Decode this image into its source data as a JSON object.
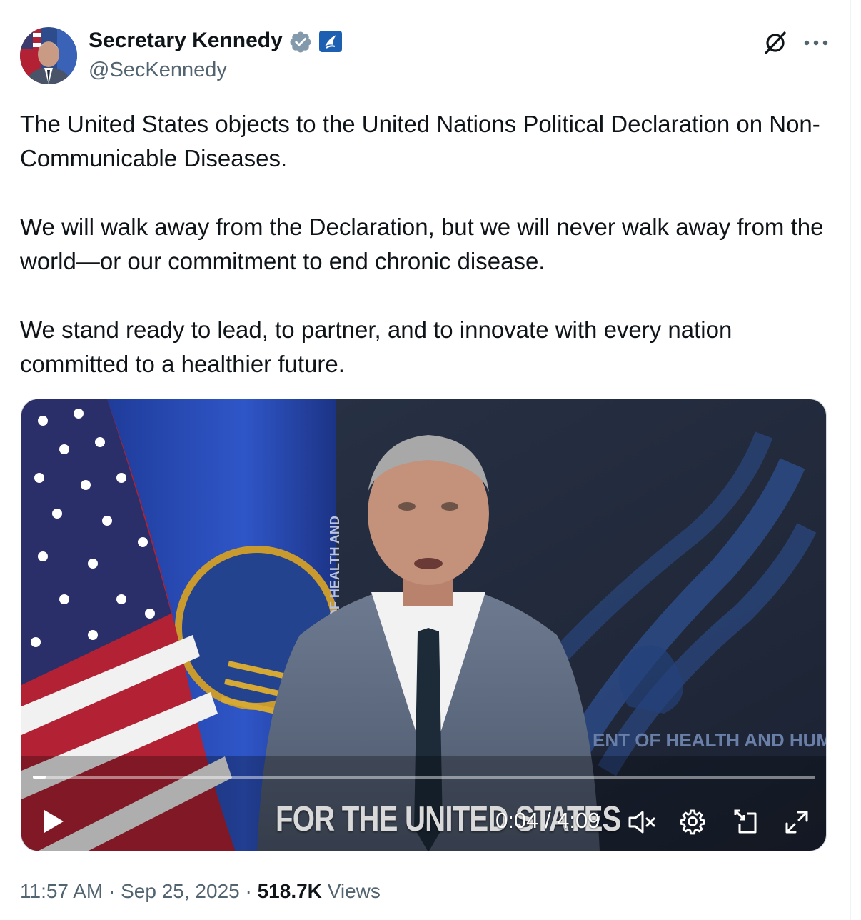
{
  "author": {
    "display_name": "Secretary Kennedy",
    "handle": "@SecKennedy",
    "verified_icon": "verified-badge-icon",
    "affiliation_icon": "hhs-affiliation-badge"
  },
  "tweet": {
    "paragraphs": [
      "The United States objects to the United Nations Political Declaration on Non-Communicable Diseases.",
      "We will walk away from the Declaration, but we will never walk away from the world—or our commitment to end chronic disease.",
      "We stand ready to lead, to partner, and to innovate with every nation committed to a healthier future."
    ]
  },
  "video": {
    "caption": "FOR THE UNITED STATES",
    "backdrop_text": "ENT OF HEALTH AND HUM",
    "flag_text": "DEPARTMENT OF HEALTH AND",
    "seal_text": "OF HEALT",
    "current_time": "0:04",
    "duration": "4:09",
    "time_display": "0:04 / 4:09",
    "progress_fraction": 0.016,
    "muted": true
  },
  "meta": {
    "time": "11:57 AM",
    "date": "Sep 25, 2025",
    "views_count": "518.7K",
    "views_label": "Views",
    "separator": "·"
  },
  "colors": {
    "text": "#0f1419",
    "secondary": "#536471",
    "verified": "#829aab",
    "affiliation": "#1d5fb0"
  }
}
